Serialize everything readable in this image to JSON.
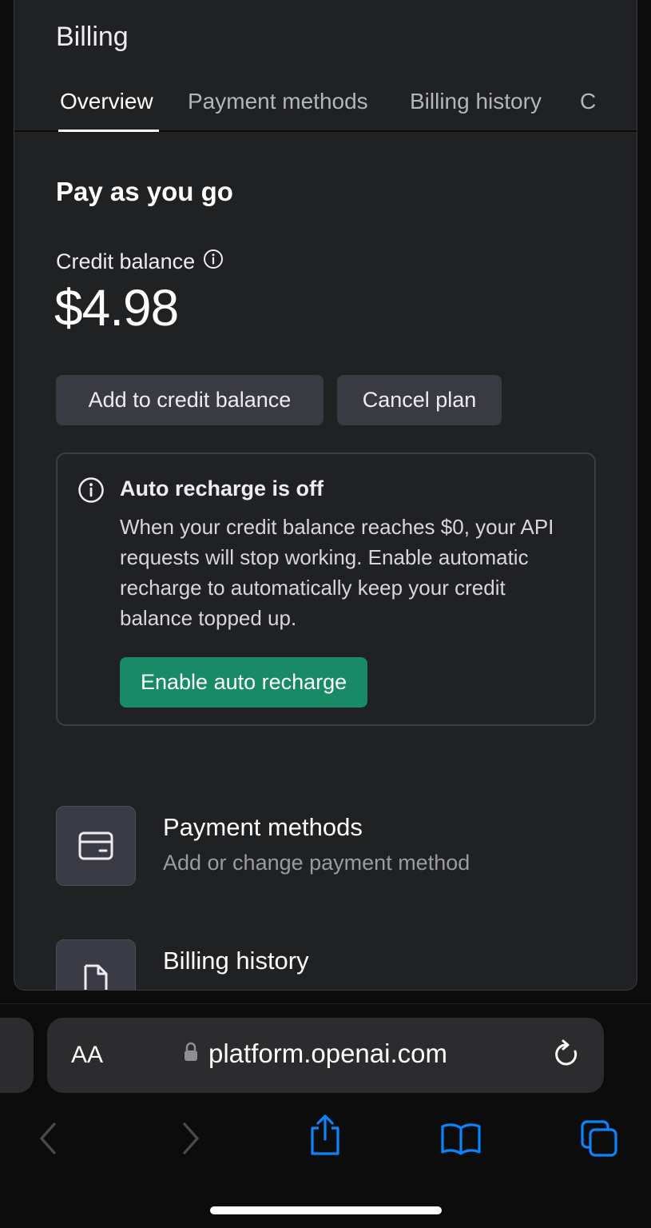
{
  "page": {
    "title": "Billing",
    "tabs": [
      {
        "label": "Overview",
        "active": true
      },
      {
        "label": "Payment methods",
        "active": false
      },
      {
        "label": "Billing history",
        "active": false
      },
      {
        "label": "C",
        "active": false
      }
    ]
  },
  "plan": {
    "title": "Pay as you go",
    "credit_label": "Credit balance",
    "credit_value": "$4.98",
    "add_credit_label": "Add to credit balance",
    "cancel_plan_label": "Cancel plan"
  },
  "notice": {
    "icon": "info-icon",
    "title": "Auto recharge is off",
    "body": "When your credit balance reaches $0, your API requests will stop working. Enable automatic recharge to automatically keep your credit balance topped up.",
    "button_label": "Enable auto recharge",
    "button_color": "#188a65"
  },
  "links": [
    {
      "icon": "credit-card-icon",
      "title": "Payment methods",
      "subtitle": "Add or change payment method"
    },
    {
      "icon": "document-icon",
      "title": "Billing history",
      "subtitle": ""
    }
  ],
  "browser": {
    "text_size_label": "AA",
    "url": "platform.openai.com",
    "accent_color": "#0a84ff",
    "toolbar_icons": [
      "back-icon",
      "forward-icon",
      "share-icon",
      "bookmarks-icon",
      "tabs-icon"
    ]
  }
}
